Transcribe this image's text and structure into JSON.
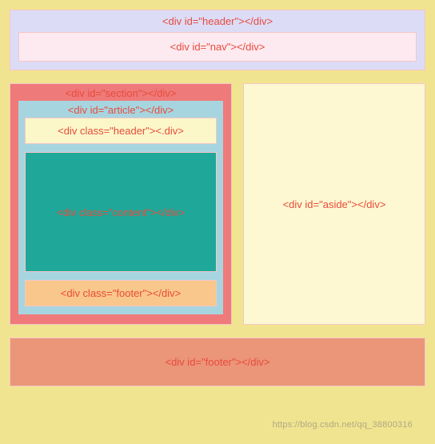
{
  "header": {
    "label": "<div id=\"header\"></div>"
  },
  "nav": {
    "label": "<div id=\"nav\"></div>"
  },
  "section": {
    "label": "<div id=\"section\"></div>"
  },
  "article": {
    "label": "<div id=\"article\"></div>"
  },
  "innerHeader": {
    "label": "<div class=\"header\"><.div>"
  },
  "content": {
    "label": "<div class=\"content\"></div>"
  },
  "innerFooter": {
    "label": "<div class=\"footer\"></div>"
  },
  "aside": {
    "label": "<div id=\"aside\"></div>"
  },
  "footer": {
    "label": "<div id=\"footer\"></div>"
  },
  "watermark": "https://blog.csdn.net/qq_38800316"
}
